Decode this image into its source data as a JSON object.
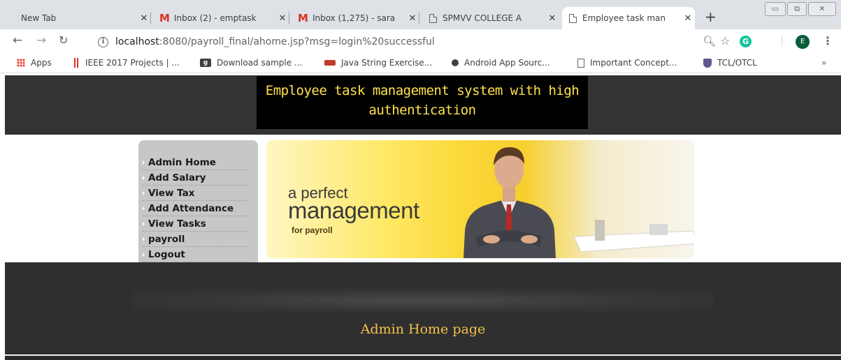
{
  "browser": {
    "tabs": [
      {
        "title": "New Tab",
        "icon": "none"
      },
      {
        "title": "Inbox (2) - emptask",
        "icon": "gmail-icon"
      },
      {
        "title": "Inbox (1,275) - sara",
        "icon": "gmail-icon"
      },
      {
        "title": "SPMVV COLLEGE A",
        "icon": "page-icon"
      },
      {
        "title": "Employee task man",
        "icon": "page-icon",
        "active": true
      }
    ],
    "new_tab": "+",
    "url_host": "localhost",
    "url_path": ":8080/payroll_final/ahome.jsp?msg=login%20successful",
    "profile_initial": "E",
    "grammarly_letter": "G",
    "bookmarks": [
      {
        "label": "Apps",
        "icon": "apps-grid-icon"
      },
      {
        "label": "IEEE 2017 Projects | ...",
        "icon": "ieee-icon"
      },
      {
        "label": "Download sample ...",
        "icon": "bookmark-g-icon"
      },
      {
        "label": "Java String Exercise...",
        "icon": "java-icon"
      },
      {
        "label": "Android App Sourc...",
        "icon": "android-icon"
      },
      {
        "label": "Important Concept...",
        "icon": "page-icon"
      },
      {
        "label": "TCL/OTCL",
        "icon": "shield-icon"
      }
    ],
    "bookmarks_more": "»"
  },
  "site": {
    "banner_line1": "Employee task management system with high",
    "banner_line2": "authentication",
    "menu": [
      "Admin Home",
      "Add Salary",
      "View Tax",
      "Add Attendance",
      "View Tasks",
      "payroll",
      "Logout"
    ],
    "hero": {
      "line1": "a perfect",
      "line2": "management",
      "line3": "for payroll"
    },
    "page_title": "Admin Home page"
  },
  "colors": {
    "header_bg": "#333333",
    "banner_text": "#ffe24a",
    "title_gold": "#f2c24a",
    "footer_bg": "#2f2f2f",
    "sidebar_bg": "#c7c7c7"
  }
}
